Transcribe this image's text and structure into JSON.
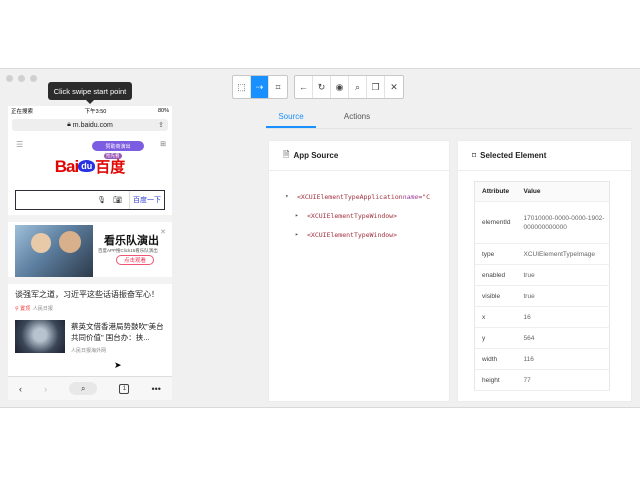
{
  "toolbar": {
    "tooltip": "Click swipe start point"
  },
  "phone": {
    "status": {
      "carrier": "正在搜索",
      "time": "下午3:50",
      "battery": "80%"
    },
    "url": "m.baidu.com",
    "pill": "赞助商演出",
    "logo": {
      "bai": "Bai",
      "du": "du",
      "cn": "百度",
      "badge": "抢先看"
    },
    "search_button": "百度一下",
    "ad": {
      "title": "看乐队演出",
      "subtitle": "百度APP搜Click15看乐队演出",
      "cta": "点击观看"
    },
    "news1": {
      "title": "谈强军之道，习近平这些话语振奋军心！",
      "tag": "置顶",
      "source": "人民日报"
    },
    "news2": {
      "title": "蔡英文借香港局势鼓吹\"美台共同价值\" 国台办：挟...",
      "source": "人民日报海外网"
    },
    "bottom": {
      "page_count": "1"
    }
  },
  "tabs": [
    {
      "label": "Source"
    },
    {
      "label": "Actions"
    }
  ],
  "source_panel": {
    "title": "App Source",
    "nodes": [
      {
        "tag": "<XCUIElementTypeApplication",
        "attr": " name",
        "eq": "=\"C"
      },
      {
        "tag": "<XCUIElementTypeWindow>"
      },
      {
        "tag": "<XCUIElementTypeWindow>"
      }
    ]
  },
  "selected_panel": {
    "title": "Selected Element",
    "headers": {
      "attribute": "Attribute",
      "value": "Value"
    },
    "rows": [
      {
        "k": "elementId",
        "v": "17010000-0000-0000-1902-000000000000"
      },
      {
        "k": "type",
        "v": "XCUIElementTypeImage"
      },
      {
        "k": "enabled",
        "v": "true"
      },
      {
        "k": "visible",
        "v": "true"
      },
      {
        "k": "x",
        "v": "16"
      },
      {
        "k": "y",
        "v": "564"
      },
      {
        "k": "width",
        "v": "116"
      },
      {
        "k": "height",
        "v": "77"
      }
    ]
  }
}
